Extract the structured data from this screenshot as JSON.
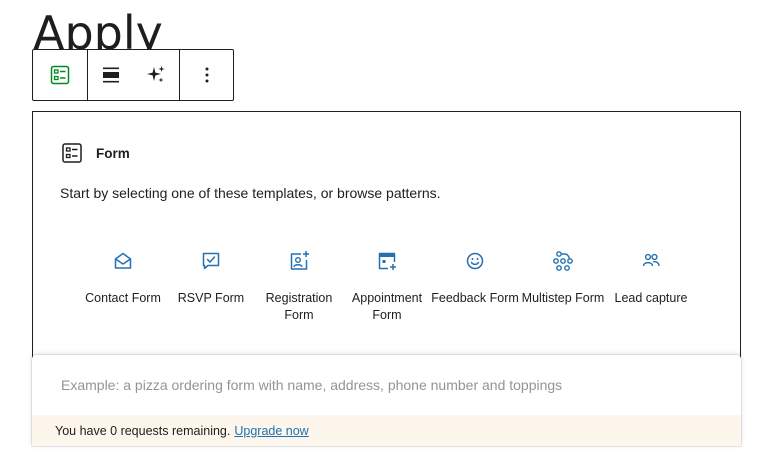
{
  "page": {
    "title": "Apply"
  },
  "toolbar": {
    "buttons": [
      {
        "name": "form-block-icon",
        "icon": "form-icon"
      },
      {
        "name": "align-button",
        "icon": "align-icon"
      },
      {
        "name": "ai-button",
        "icon": "sparkle-icon"
      },
      {
        "name": "more-options-button",
        "icon": "kebab-icon"
      }
    ],
    "accent_color": "#008a20"
  },
  "form_block": {
    "label": "Form",
    "instructions": "Start by selecting one of these templates, or browse patterns.",
    "templates": [
      {
        "label": "Contact Form",
        "icon": "envelope-icon"
      },
      {
        "label": "RSVP Form",
        "icon": "rsvp-icon"
      },
      {
        "label": "Registration Form",
        "icon": "registration-icon"
      },
      {
        "label": "Appointment Form",
        "icon": "calendar-plus-icon"
      },
      {
        "label": "Feedback Form",
        "icon": "smiley-icon"
      },
      {
        "label": "Multistep Form",
        "icon": "multistep-icon"
      },
      {
        "label": "Lead capture",
        "icon": "people-icon"
      }
    ],
    "icon_color": "#2271b1"
  },
  "ai_panel": {
    "placeholder": "Example: a pizza ordering form with name, address, phone number and toppings",
    "value": "",
    "requests_text": "You have 0 requests remaining.",
    "upgrade_label": "Upgrade now"
  }
}
